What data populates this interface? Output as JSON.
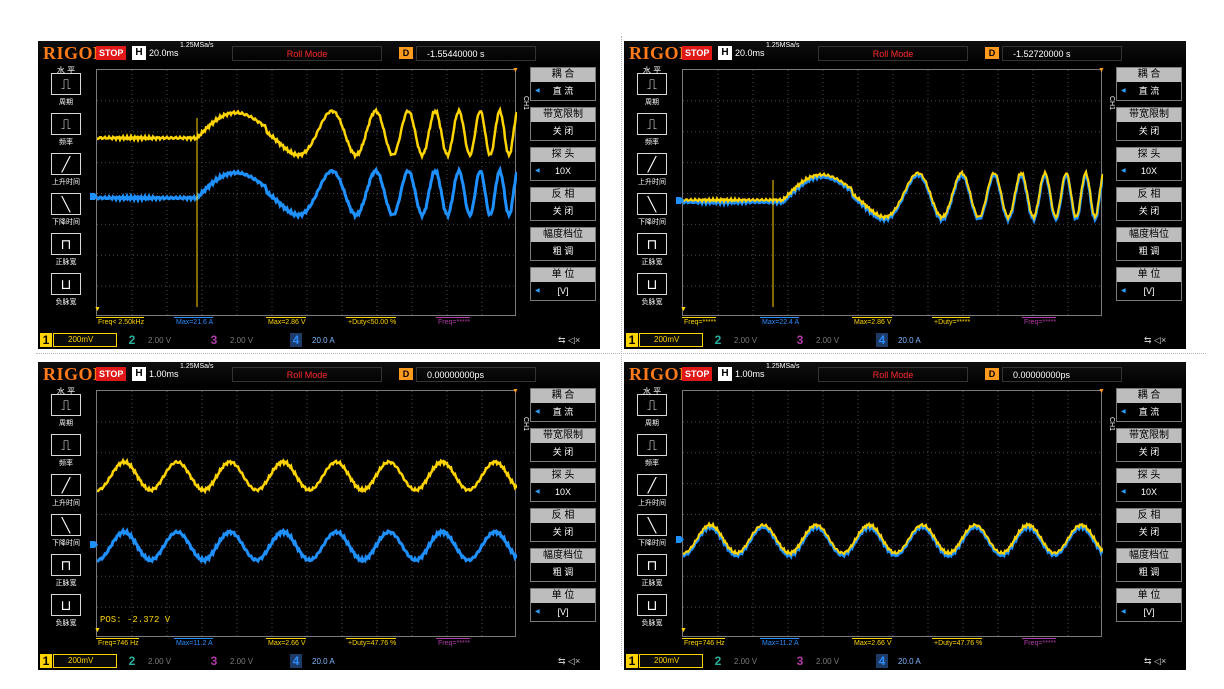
{
  "screens": [
    {
      "brand": "RIGOL",
      "status": "STOP",
      "timebase_label": "H",
      "timebase": "20.0ms",
      "sample_rate": "1.25MSa/s",
      "mode": "Roll Mode",
      "delay_label": "D",
      "delay": "-1.55440000 s",
      "measurements": [
        "Freq< 2.50kHz",
        "Max=21.6 A",
        "Max=2.86 V",
        "+Duty<50.00 %",
        "Freq=*****"
      ],
      "pos_text": "",
      "overlapped": false,
      "signal": "sweep"
    },
    {
      "brand": "RIGOL",
      "status": "STOP",
      "timebase_label": "H",
      "timebase": "20.0ms",
      "sample_rate": "1.25MSa/s",
      "mode": "Roll Mode",
      "delay_label": "D",
      "delay": "-1.52720000 s",
      "measurements": [
        "Freq=*****",
        "Max=22.4 A",
        "Max=2.86 V",
        "+Duty=*****",
        "Freq=*****"
      ],
      "pos_text": "",
      "overlapped": true,
      "signal": "sweep"
    },
    {
      "brand": "RIGOL",
      "status": "STOP",
      "timebase_label": "H",
      "timebase": "1.00ms",
      "sample_rate": "1.25MSa/s",
      "mode": "Roll Mode",
      "delay_label": "D",
      "delay": "0.00000000ps",
      "measurements": [
        "Freq=746 Hz",
        "Max=11.2 A",
        "Max=2.66 V",
        "+Duty=47.76 %",
        "Freq=*****"
      ],
      "pos_text": "POS: -2.372 V",
      "overlapped": false,
      "signal": "sine"
    },
    {
      "brand": "RIGOL",
      "status": "STOP",
      "timebase_label": "H",
      "timebase": "1.00ms",
      "sample_rate": "1.25MSa/s",
      "mode": "Roll Mode",
      "delay_label": "D",
      "delay": "0.00000000ps",
      "measurements": [
        "Freq=746 Hz",
        "Max=11.2 A",
        "Max=2.66 V",
        "+Duty=47.76 %",
        "Freq=*****"
      ],
      "pos_text": "",
      "overlapped": true,
      "signal": "sine"
    }
  ],
  "left_menu": {
    "header": "水 平",
    "items": [
      {
        "label": "周期",
        "icon": "period-icon"
      },
      {
        "label": "频率",
        "icon": "frequency-icon"
      },
      {
        "label": "上升时间",
        "icon": "rise-time-icon"
      },
      {
        "label": "下降时间",
        "icon": "fall-time-icon"
      },
      {
        "label": "正脉宽",
        "icon": "positive-width-icon"
      },
      {
        "label": "负脉宽",
        "icon": "negative-width-icon"
      }
    ]
  },
  "right_menu": [
    {
      "title": "耦 合",
      "value": "直 流"
    },
    {
      "title": "带宽限制",
      "value": "关 闭"
    },
    {
      "title": "探 头",
      "value": "10X"
    },
    {
      "title": "反 相",
      "value": "关 闭"
    },
    {
      "title": "幅度档位",
      "value": "粗 调"
    },
    {
      "title": "单 位",
      "value": "[V]"
    }
  ],
  "ch_side_label": "CH1",
  "channels": [
    {
      "num": "1",
      "scale": "200mV",
      "color": "#ffd400"
    },
    {
      "num": "2",
      "scale": "2.00 V",
      "color": "#27b0a0"
    },
    {
      "num": "3",
      "scale": "2.00 V",
      "color": "#b23aa8"
    },
    {
      "num": "4",
      "scale": "20.0 A",
      "color": "#2a8cff"
    }
  ],
  "colors": {
    "ch1": "#ffd400",
    "ch4": "#1e90ff",
    "accent": "#ff7a18",
    "stop": "#e01818"
  },
  "usb_icon": "usb-icon"
}
